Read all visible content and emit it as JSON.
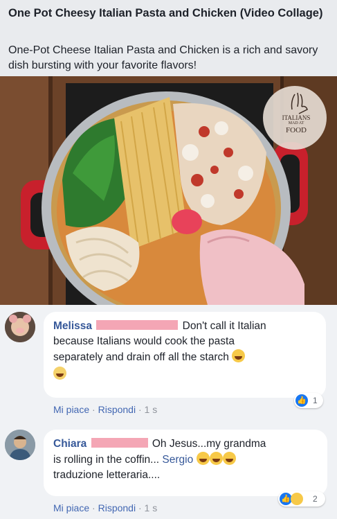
{
  "post": {
    "title": "One Pot Cheesy Italian Pasta and Chicken (Video Collage)",
    "description": "One-Pot Cheese Italian Pasta and Chicken is a rich and savory dish bursting with your favorite flavors!"
  },
  "watermark": {
    "line1": "ITALIANS",
    "line2": "MAD AT",
    "line3": "FOOD"
  },
  "colors": {
    "author": "#365899",
    "action": "#4267b2",
    "like_badge": "#1877f2",
    "redaction": "#f4a6b5"
  },
  "comments": [
    {
      "author": "Melissa",
      "text_line1": "Don't call it Italian",
      "text_line2": "because Italians would cook the pasta",
      "text_line3": "separately and drain off all the starch",
      "like_label": "Mi piace",
      "reply_label": "Rispondi",
      "time": "1 s",
      "reaction_count": "1"
    },
    {
      "author": "Chiara",
      "text_line1": "Oh Jesus...my grandma",
      "text_line2": "is rolling in the coffin...",
      "mention": "Sergio",
      "text_line3": "traduzione letteraria....",
      "like_label": "Mi piace",
      "reply_label": "Rispondi",
      "time": "1 s",
      "reaction_count": "2"
    }
  ]
}
